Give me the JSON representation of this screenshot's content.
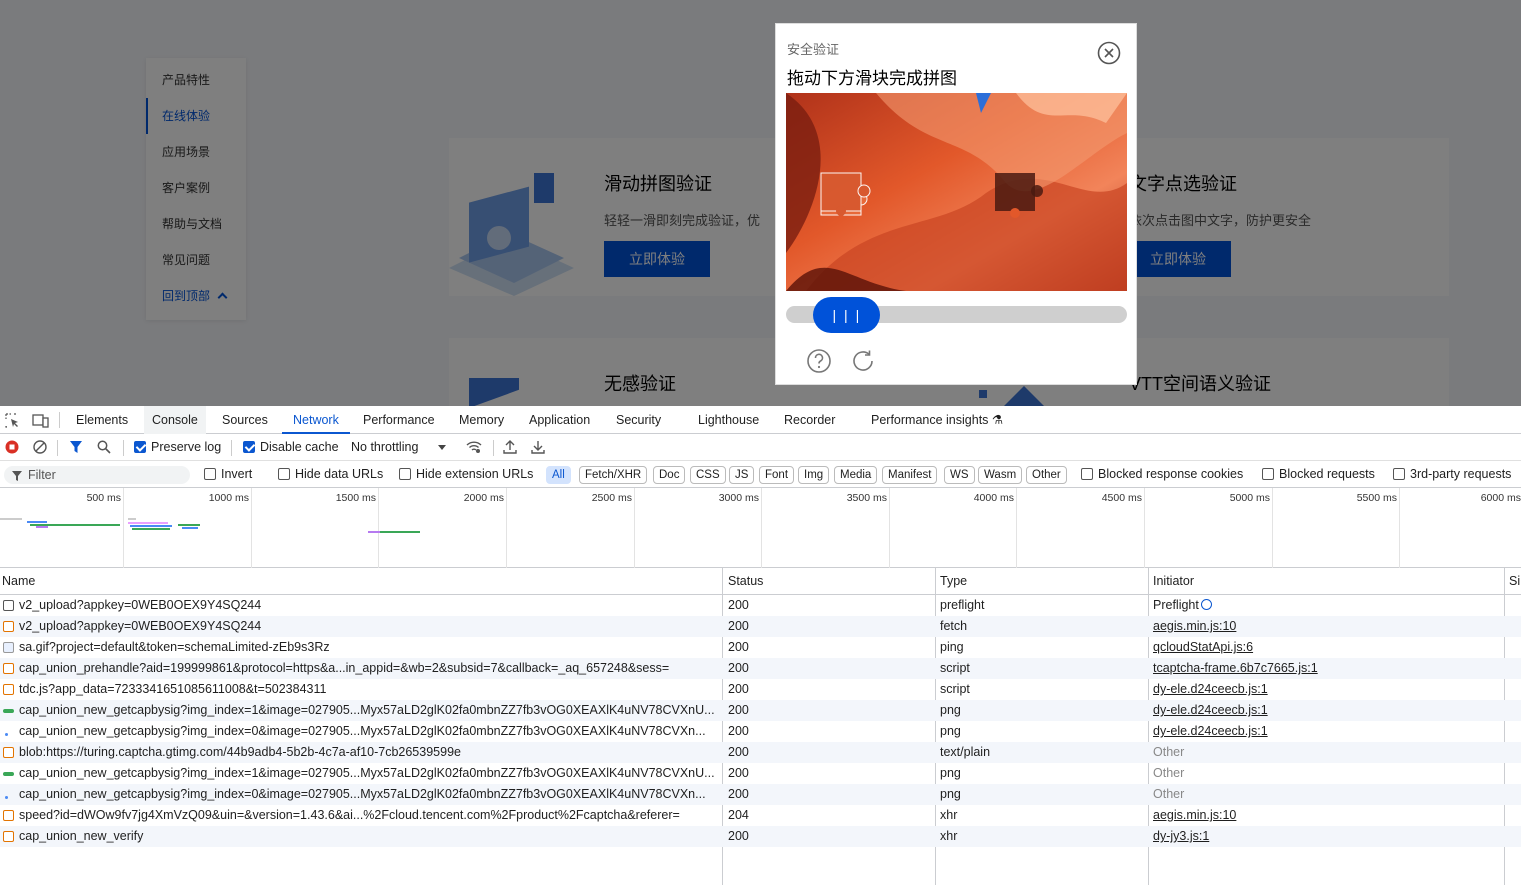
{
  "site": {
    "nav": [
      "产品特性",
      "在线体验",
      "应用场景",
      "客户案例",
      "帮助与文档",
      "常见问题",
      "回到顶部"
    ],
    "cards": [
      {
        "title": "滑动拼图验证",
        "desc": "轻轻一滑即刻完成验证，优",
        "button": "立即体验"
      },
      {
        "title": "文字点选验证",
        "desc": "依次点击图中文字，防护更安全",
        "button": "立即体验"
      },
      {
        "title": "无感验证"
      },
      {
        "title": "VTT空间语义验证"
      }
    ]
  },
  "captcha": {
    "subtitle": "安全验证",
    "title": "拖动下方滑块完成拼图",
    "handle_label": "| | |",
    "slider_position": 0.1
  },
  "devtools": {
    "tabs": [
      "Elements",
      "Console",
      "Sources",
      "Network",
      "Performance",
      "Memory",
      "Application",
      "Security",
      "Lighthouse",
      "Recorder",
      "Performance insights"
    ],
    "active_tab": "Network",
    "toolbar": {
      "preserve_log": "Preserve log",
      "disable_cache": "Disable cache",
      "throttling": "No throttling"
    },
    "filter": {
      "placeholder": "Filter",
      "invert": "Invert",
      "hide_data_urls": "Hide data URLs",
      "hide_extension_urls": "Hide extension URLs",
      "types": [
        "All",
        "Fetch/XHR",
        "Doc",
        "CSS",
        "JS",
        "Font",
        "Img",
        "Media",
        "Manifest",
        "WS",
        "Wasm",
        "Other"
      ],
      "blocked_cookies": "Blocked response cookies",
      "blocked_requests": "Blocked requests",
      "third_party": "3rd-party requests"
    },
    "overview_ticks": [
      "500 ms",
      "1000 ms",
      "1500 ms",
      "2000 ms",
      "2500 ms",
      "3000 ms",
      "3500 ms",
      "4000 ms",
      "4500 ms",
      "5000 ms",
      "5500 ms",
      "6000 ms"
    ],
    "columns": [
      "Name",
      "Status",
      "Type",
      "Initiator",
      "Si"
    ],
    "rows": [
      {
        "name": "v2_upload?appkey=0WEB0OEX9Y4SQ244",
        "status": "200",
        "type": "preflight",
        "initiator": "Preflight",
        "icon": "preflight"
      },
      {
        "name": "v2_upload?appkey=0WEB0OEX9Y4SQ244",
        "status": "200",
        "type": "fetch",
        "initiator": "aegis.min.js:10",
        "icon": "xhr"
      },
      {
        "name": "sa.gif?project=default&token=schemaLimited-zEb9s3Rz",
        "status": "200",
        "type": "ping",
        "initiator": "qcloudStatApi.js:6",
        "icon": "image"
      },
      {
        "name": "cap_union_prehandle?aid=199999861&protocol=https&a...in_appid=&wb=2&subsid=7&callback=_aq_657248&sess=",
        "status": "200",
        "type": "script",
        "initiator": "tcaptcha-frame.6b7c7665.js:1",
        "icon": "script"
      },
      {
        "name": "tdc.js?app_data=7233341651085611008&t=502384311",
        "status": "200",
        "type": "script",
        "initiator": "dy-ele.d24ceecb.js:1",
        "icon": "script"
      },
      {
        "name": "cap_union_new_getcapbysig?img_index=1&image=027905...Myx57aLD2glK02fa0mbnZZ7fb3vOG0XEAXlK4uNV78CVXnU...",
        "status": "200",
        "type": "png",
        "initiator": "dy-ele.d24ceecb.js:1",
        "icon": "png"
      },
      {
        "name": "cap_union_new_getcapbysig?img_index=0&image=027905...Myx57aLD2glK02fa0mbnZZ7fb3vOG0XEAXlK4uNV78CVXn...",
        "status": "200",
        "type": "png",
        "initiator": "dy-ele.d24ceecb.js:1",
        "icon": "png-small"
      },
      {
        "name": "blob:https://turing.captcha.gtimg.com/44b9adb4-5b2b-4c7a-af10-7cb26539599e",
        "status": "200",
        "type": "text/plain",
        "initiator": "Other",
        "icon": "script"
      },
      {
        "name": "cap_union_new_getcapbysig?img_index=1&image=027905...Myx57aLD2glK02fa0mbnZZ7fb3vOG0XEAXlK4uNV78CVXnU...",
        "status": "200",
        "type": "png",
        "initiator": "Other",
        "icon": "png"
      },
      {
        "name": "cap_union_new_getcapbysig?img_index=0&image=027905...Myx57aLD2glK02fa0mbnZZ7fb3vOG0XEAXlK4uNV78CVXn...",
        "status": "200",
        "type": "png",
        "initiator": "Other",
        "icon": "png-small"
      },
      {
        "name": "speed?id=dWOw9fv7jg4XmVzQ09&uin=&version=1.43.6&ai...%2Fcloud.tencent.com%2Fproduct%2Fcaptcha&referer=",
        "status": "204",
        "type": "xhr",
        "initiator": "aegis.min.js:10",
        "icon": "xhr"
      },
      {
        "name": "cap_union_new_verify",
        "status": "200",
        "type": "xhr",
        "initiator": "dy-jy3.js:1",
        "icon": "xhr"
      }
    ]
  }
}
